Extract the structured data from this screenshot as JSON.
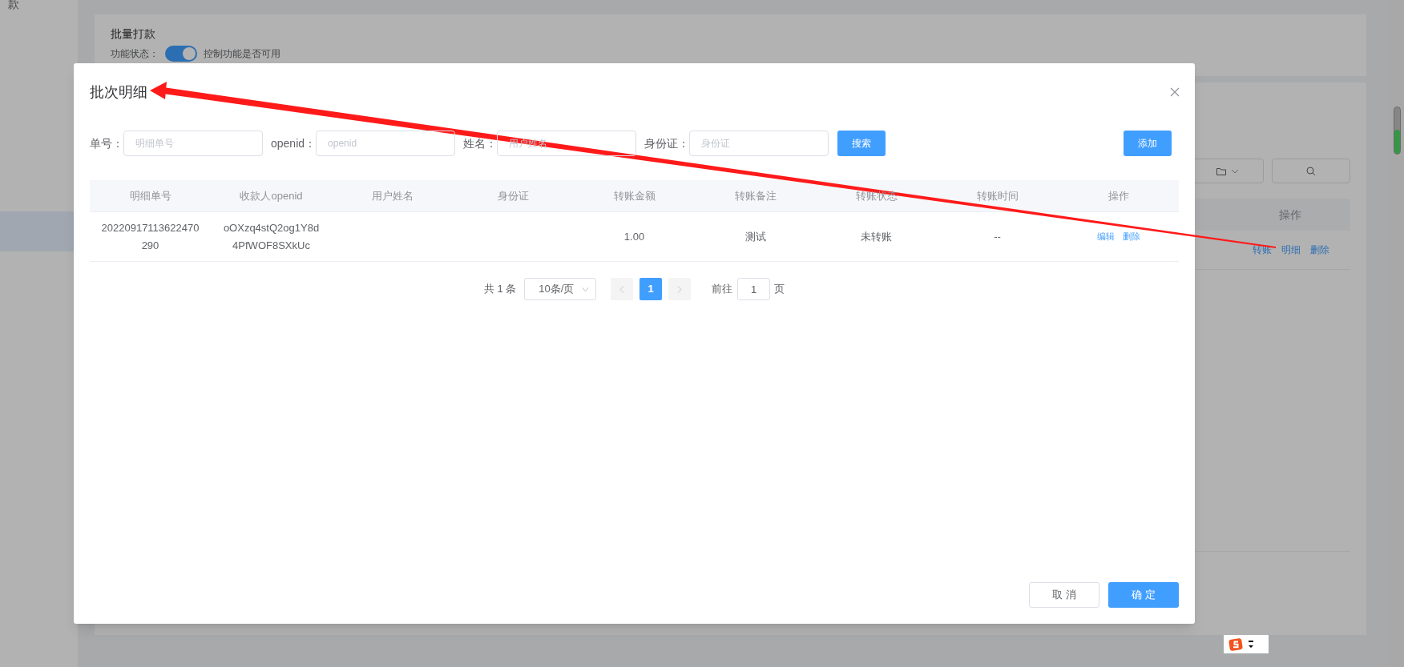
{
  "background": {
    "nav_label": "款",
    "card_title": "批量打款",
    "status_label": "功能状态：",
    "status_on": true,
    "status_hint": "控制功能是否可用",
    "column_actions": "操作",
    "row_actions": [
      "转账",
      "明细",
      "删除"
    ]
  },
  "dialog": {
    "title": "批次明细",
    "filters": [
      {
        "label": "单号：",
        "placeholder": "明细单号"
      },
      {
        "label": "openid：",
        "placeholder": "openid"
      },
      {
        "label": "姓名：",
        "placeholder": "用户姓名"
      },
      {
        "label": "身份证：",
        "placeholder": "身份证"
      }
    ],
    "search_button": "搜索",
    "add_button": "添加",
    "table": {
      "columns": [
        "明细单号",
        "收款人openid",
        "用户姓名",
        "身份证",
        "转账金额",
        "转账备注",
        "转账状态",
        "转账时间",
        "操作"
      ],
      "rows": [
        {
          "cells": [
            "20220917113622470290",
            "oOXzq4stQ2og1Y8d4PfWOF8SXkUc",
            "",
            "",
            "1.00",
            "测试",
            "未转账",
            "--"
          ],
          "actions": [
            "编辑",
            "删除"
          ]
        }
      ]
    },
    "pagination": {
      "total": "共 1 条",
      "page_size": "10条/页",
      "pages": [
        {
          "label": "1",
          "selected": true
        }
      ],
      "goto_label": "前往",
      "goto_value": "1",
      "goto_suffix": "页"
    },
    "buttons": [
      {
        "label": "取 消",
        "kind": "default"
      },
      {
        "label": "确 定",
        "kind": "primary"
      }
    ]
  }
}
